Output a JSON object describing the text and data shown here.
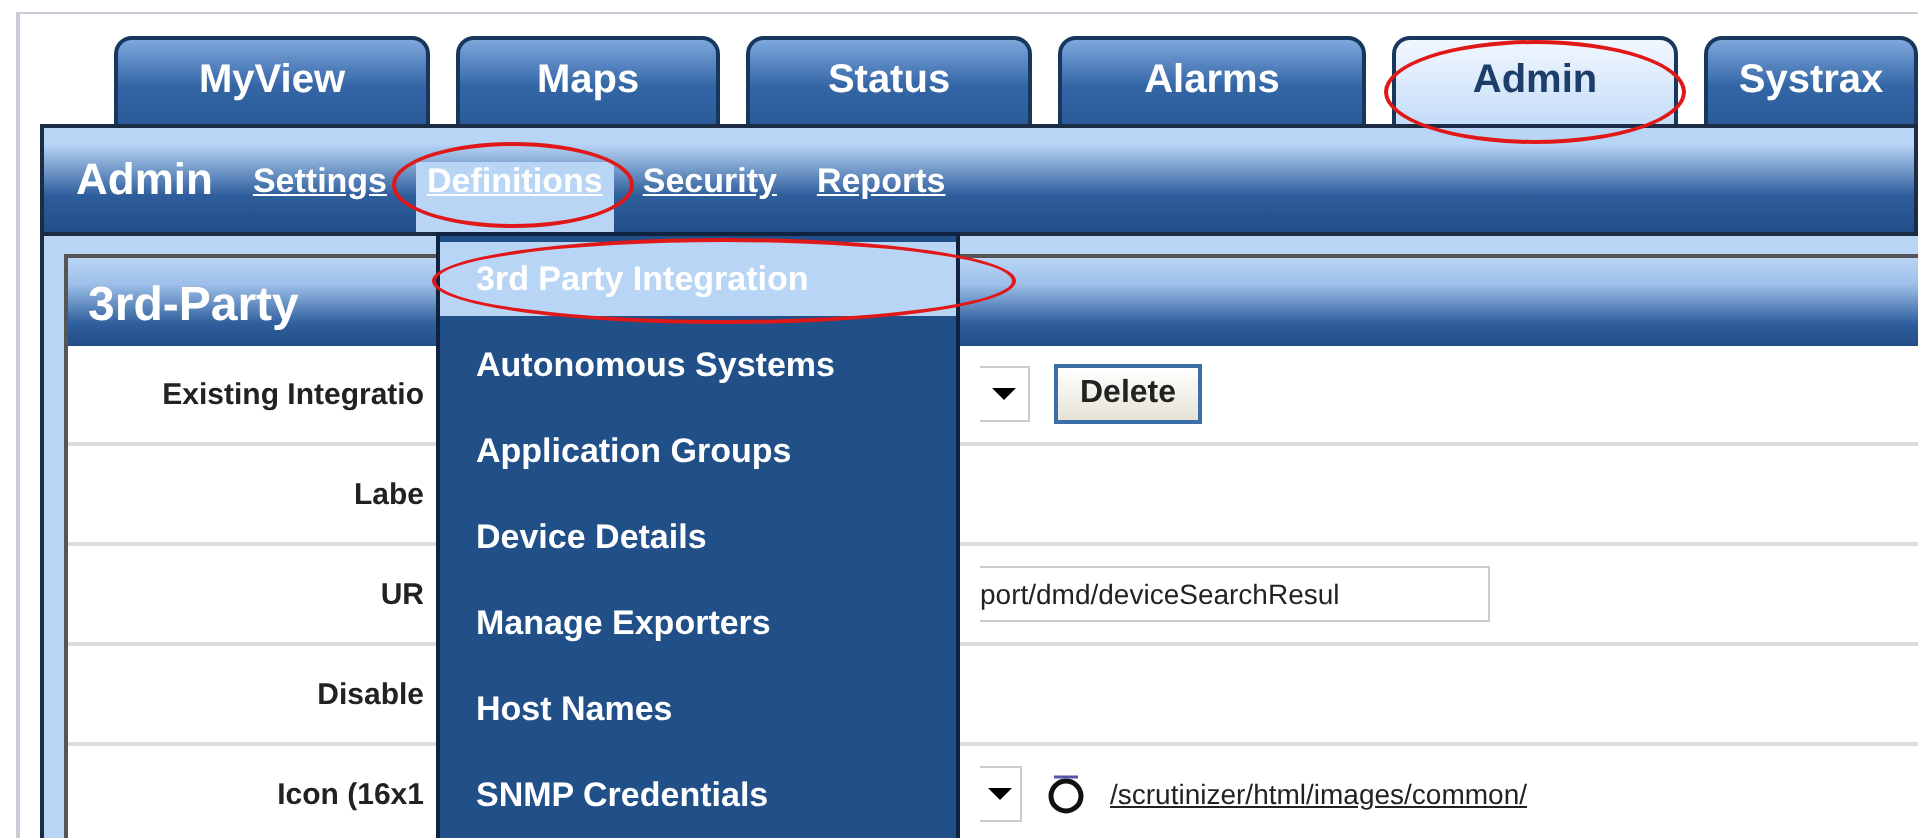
{
  "tabs": [
    {
      "label": "MyView",
      "selected": false,
      "circled": false
    },
    {
      "label": "Maps",
      "selected": false,
      "circled": false
    },
    {
      "label": "Status",
      "selected": false,
      "circled": false
    },
    {
      "label": "Alarms",
      "selected": false,
      "circled": false
    },
    {
      "label": "Admin",
      "selected": true,
      "circled": true
    },
    {
      "label": "Systrax",
      "selected": false,
      "circled": false
    }
  ],
  "subnav": {
    "title": "Admin",
    "links": [
      {
        "label": "Settings",
        "selected": false,
        "circled": false
      },
      {
        "label": "Definitions",
        "selected": true,
        "circled": true
      },
      {
        "label": "Security",
        "selected": false,
        "circled": false
      },
      {
        "label": "Reports",
        "selected": false,
        "circled": false
      }
    ]
  },
  "section": {
    "title": "3rd-Party",
    "rows": [
      {
        "kind": "select-delete",
        "label": "Existing Integratio",
        "button": "Delete"
      },
      {
        "kind": "blank",
        "label": "Labe"
      },
      {
        "kind": "input",
        "label": "UR",
        "value": "port/dmd/deviceSearchResul"
      },
      {
        "kind": "blank",
        "label": "Disable"
      },
      {
        "kind": "icon-select",
        "label": "Icon (16x1",
        "path": "/scrutinizer/html/images/common/"
      }
    ]
  },
  "menu": {
    "items": [
      {
        "label": "3rd Party Integration",
        "selected": true,
        "circled": true
      },
      {
        "label": "Autonomous Systems",
        "selected": false,
        "circled": false
      },
      {
        "label": "Application Groups",
        "selected": false,
        "circled": false
      },
      {
        "label": "Device Details",
        "selected": false,
        "circled": false
      },
      {
        "label": "Manage Exporters",
        "selected": false,
        "circled": false
      },
      {
        "label": "Host Names",
        "selected": false,
        "circled": false
      },
      {
        "label": "SNMP Credentials",
        "selected": false,
        "circled": false
      }
    ]
  }
}
